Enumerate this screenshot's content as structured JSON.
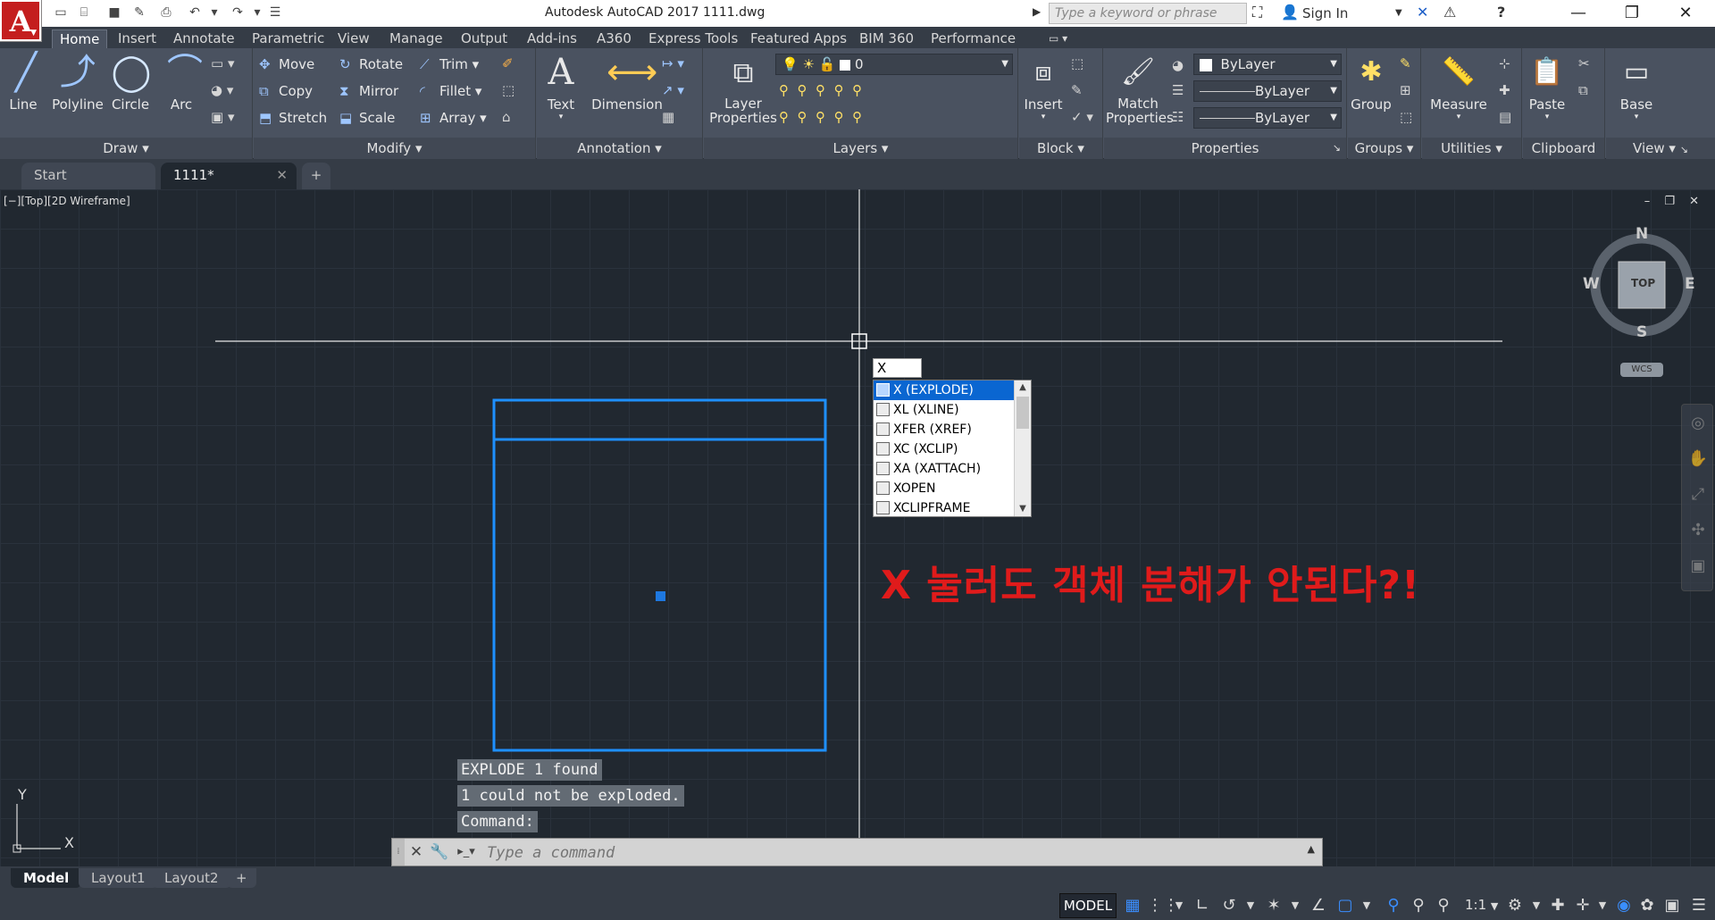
{
  "title_bar": {
    "app_title": "Autodesk AutoCAD 2017      1111.dwg",
    "search_placeholder": "Type a keyword or phrase",
    "sign_in": "Sign In"
  },
  "ribbon_tabs": [
    "Home",
    "Insert",
    "Annotate",
    "Parametric",
    "View",
    "Manage",
    "Output",
    "Add-ins",
    "A360",
    "Express Tools",
    "Featured Apps",
    "BIM 360",
    "Performance"
  ],
  "panels": {
    "draw": {
      "title": "Draw",
      "buttons": [
        "Line",
        "Polyline",
        "Circle",
        "Arc"
      ]
    },
    "modify": {
      "title": "Modify",
      "buttons": [
        "Move",
        "Rotate",
        "Trim",
        "Copy",
        "Mirror",
        "Fillet",
        "Stretch",
        "Scale",
        "Array"
      ]
    },
    "annotation": {
      "title": "Annotation",
      "buttons": [
        "Text",
        "Dimension"
      ]
    },
    "layers": {
      "title": "Layers",
      "layer_properties": "Layer\nProperties",
      "current_layer": "0"
    },
    "block": {
      "title": "Block",
      "insert": "Insert"
    },
    "properties": {
      "title": "Properties",
      "match_properties": "Match\nProperties",
      "color": "ByLayer",
      "linetype": "ByLayer",
      "lineweight": "ByLayer"
    },
    "groups": {
      "title": "Groups",
      "group": "Group"
    },
    "utilities": {
      "title": "Utilities",
      "measure": "Measure"
    },
    "clipboard": {
      "title": "Clipboard",
      "paste": "Paste"
    },
    "view": {
      "title": "View",
      "base": "Base"
    }
  },
  "doc_tabs": [
    "Start",
    "1111*"
  ],
  "viewport_label": "[−][Top][2D Wireframe]",
  "viewcube": {
    "top": "TOP",
    "north": "N",
    "south": "S",
    "east": "E",
    "west": "W",
    "wcs": "WCS"
  },
  "ucs": {
    "x": "X",
    "y": "Y"
  },
  "autocomplete": {
    "input_value": "X",
    "items": [
      "X (EXPLODE)",
      "XL (XLINE)",
      "XFER (XREF)",
      "XC (XCLIP)",
      "XA (XATTACH)",
      "XOPEN",
      "XCLIPFRAME"
    ],
    "selected_index": 0
  },
  "annotation_text": "X 눌러도 객체 분해가 안된다?!",
  "command_history": [
    "EXPLODE 1 found",
    "1 could not be exploded.",
    "Command:"
  ],
  "command_line": {
    "placeholder": "Type a command"
  },
  "layout_tabs": [
    "Model",
    "Layout1",
    "Layout2"
  ],
  "status_bar": {
    "model": "MODEL",
    "scale": "1:1"
  },
  "colors": {
    "canvas_bg": "#212830",
    "selection_blue": "#1e90ff",
    "annotation_red": "#e01b1b",
    "app_red": "#c41e1e"
  }
}
